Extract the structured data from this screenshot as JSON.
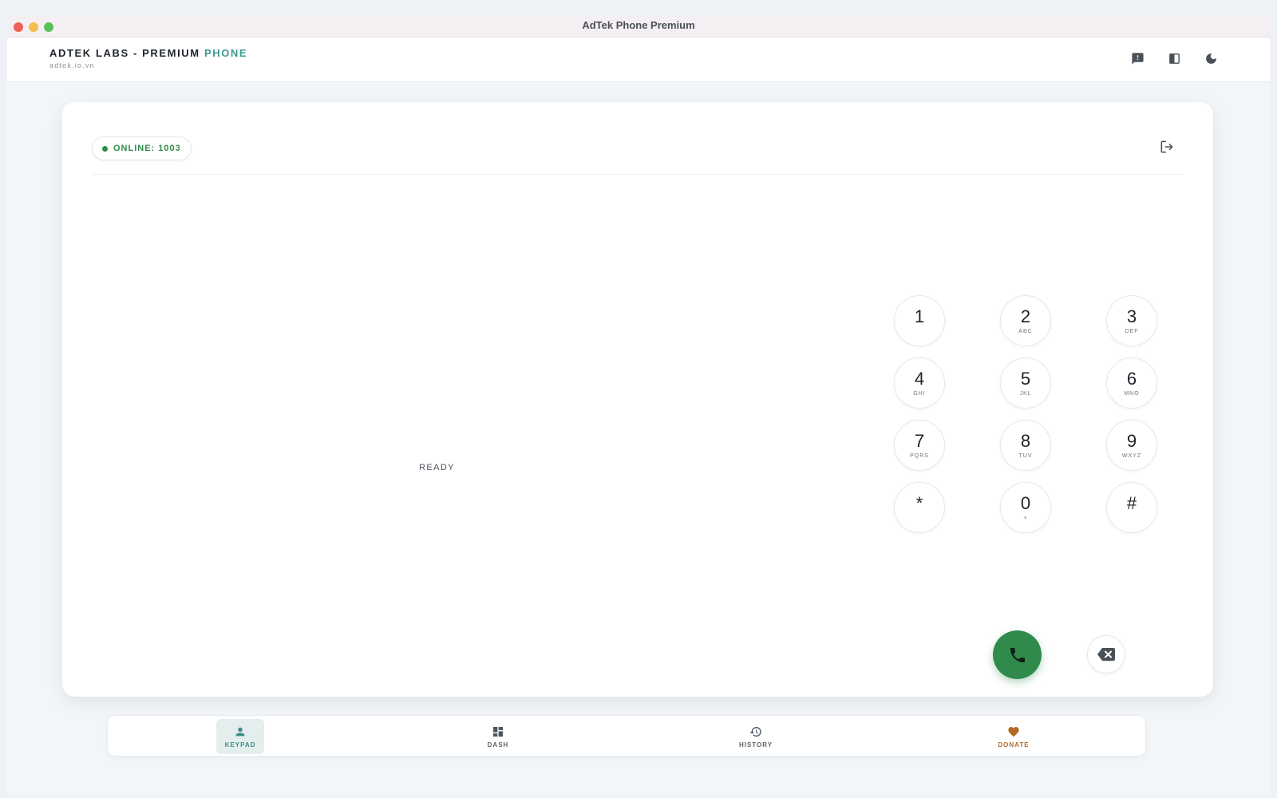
{
  "window": {
    "title": "AdTek Phone Premium"
  },
  "header": {
    "brand_prefix": "ADTEK LABS - PREMIUM",
    "brand_accent": "PHONE",
    "subtitle": "adtek.io.vn",
    "icons": [
      "feedback-icon",
      "panel-icon",
      "dark-mode-icon"
    ]
  },
  "status": {
    "text": "ONLINE: 1003",
    "color": "#2e8b4a"
  },
  "phone": {
    "state": "READY"
  },
  "keypad": [
    {
      "digit": "1",
      "letters": ""
    },
    {
      "digit": "2",
      "letters": "ABC"
    },
    {
      "digit": "3",
      "letters": "DEF"
    },
    {
      "digit": "4",
      "letters": "GHI"
    },
    {
      "digit": "5",
      "letters": "JKL"
    },
    {
      "digit": "6",
      "letters": "MNO"
    },
    {
      "digit": "7",
      "letters": "PQRS"
    },
    {
      "digit": "8",
      "letters": "TUV"
    },
    {
      "digit": "9",
      "letters": "WXYZ"
    },
    {
      "digit": "*",
      "letters": ""
    },
    {
      "digit": "0",
      "letters": "+"
    },
    {
      "digit": "#",
      "letters": ""
    }
  ],
  "actions": {
    "call_icon": "phone-icon",
    "backspace_icon": "backspace-icon",
    "call_color": "#2f8a4c"
  },
  "nav": {
    "keypad": "KEYPAD",
    "dash": "DASH",
    "history": "HISTORY",
    "donate": "DONATE",
    "active": "KEYPAD",
    "accent": "#3c8d88",
    "donate_color": "#b26a24"
  }
}
